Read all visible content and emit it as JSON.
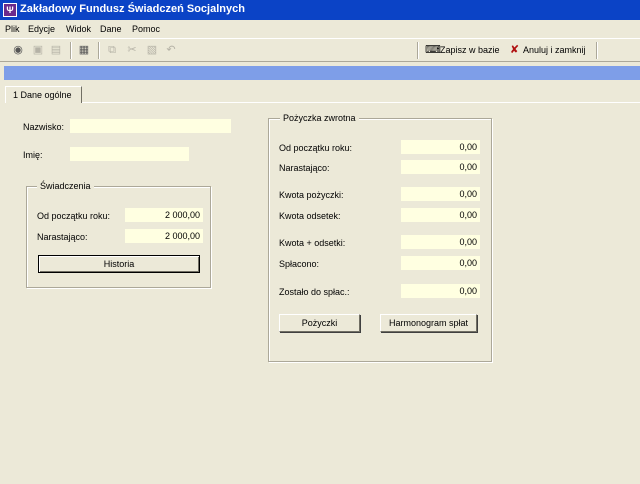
{
  "window": {
    "title": "Zakładowy Fundusz Świadczeń Socjalnych",
    "app_icon": "app-icon"
  },
  "menu": [
    "Plik",
    "Edycje",
    "Widok",
    "Dane",
    "Pomoc"
  ],
  "toolbar": {
    "icons": [
      "binoculars-icon",
      "save-icon",
      "print-icon",
      "properties-icon",
      "copy-icon",
      "cut-icon",
      "paste-icon",
      "undo-icon"
    ],
    "save_to_db": "Zapisz w bazie",
    "cancel_close": "Anuluj i zamknij"
  },
  "tabs": [
    {
      "label": "1 Dane ogólne"
    }
  ],
  "person": {
    "surname_label": "Nazwisko:",
    "surname_value": "",
    "name_label": "Imię:",
    "name_value": ""
  },
  "benefits": {
    "title": "Świadczenia",
    "from_year_label": "Od początku roku:",
    "from_year_value": "2 000,00",
    "cumulative_label": "Narastająco:",
    "cumulative_value": "2 000,00",
    "history_button": "Historia"
  },
  "loan": {
    "title": "Pożyczka zwrotna",
    "rows": [
      {
        "label": "Od początku roku:",
        "value": "0,00"
      },
      {
        "label": "Narastająco:",
        "value": "0,00"
      },
      {
        "label": "Kwota pożyczki:",
        "value": "0,00"
      },
      {
        "label": "Kwota odsetek:",
        "value": "0,00"
      },
      {
        "label": "Kwota + odsetki:",
        "value": "0,00"
      },
      {
        "label": "Spłacono:",
        "value": "0,00"
      },
      {
        "label": "Zostało do spłac.:",
        "value": "0,00"
      }
    ],
    "loans_button": "Pożyczki",
    "schedule_button": "Harmonogram spłat"
  },
  "colors": {
    "title_bar": "#0B43C6",
    "field_bg": "#FFFFE1",
    "strip": "#7E9EE8",
    "window_bg": "#ECE9D8"
  }
}
